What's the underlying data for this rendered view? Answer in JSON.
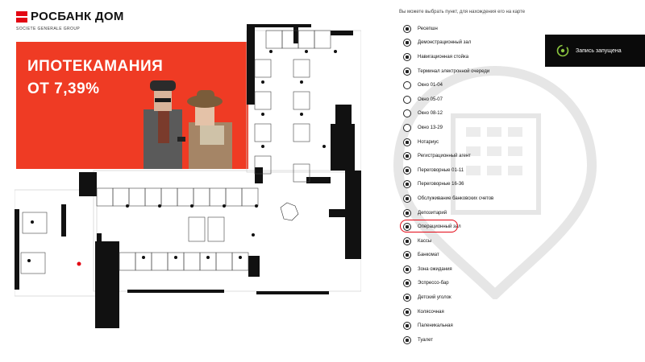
{
  "brand": {
    "name": "РОСБАНК ДОМ",
    "subtitle": "SOCIETE GENERALE GROUP",
    "color": "#e30613"
  },
  "promo": {
    "title": "ИПОТЕКАМАНИЯ",
    "rate": "ОТ 7,39%",
    "background": "#ef3b24"
  },
  "hint": "Вы можете выбрать пункт, для нахождения его на карте",
  "legend": [
    {
      "label": "Ресепшн",
      "icon": "reception-icon"
    },
    {
      "label": "Демонстрационный зал",
      "icon": "showroom-icon"
    },
    {
      "label": "Навигационная стойка",
      "icon": "navigation-stand-icon"
    },
    {
      "label": "Терминал электронной очереди",
      "icon": "queue-terminal-icon"
    },
    {
      "label": "Окно 01-04",
      "icon": "window-icon"
    },
    {
      "label": "Окно 05-07",
      "icon": "window-icon"
    },
    {
      "label": "Окно 08-12",
      "icon": "window-icon"
    },
    {
      "label": "Окно 13-29",
      "icon": "window-icon"
    },
    {
      "label": "Нотариус",
      "icon": "notary-icon"
    },
    {
      "label": "Регистрационный агент",
      "icon": "registration-agent-icon"
    },
    {
      "label": "Переговорные 01-11",
      "icon": "meeting-room-icon"
    },
    {
      "label": "Переговорные 16-36",
      "icon": "meeting-room-icon"
    },
    {
      "label": "Обслуживание банковских счетов",
      "icon": "bank-account-icon"
    },
    {
      "label": "Депозитарий",
      "icon": "depository-icon"
    },
    {
      "label": "Операционный зал",
      "icon": "operations-hall-icon",
      "selected": true
    },
    {
      "label": "Кассы",
      "icon": "cashier-icon"
    },
    {
      "label": "Банкомат",
      "icon": "atm-icon"
    },
    {
      "label": "Зона ожидания",
      "icon": "waiting-area-icon"
    },
    {
      "label": "Эспрессо-бар",
      "icon": "espresso-bar-icon"
    },
    {
      "label": "Детский уголок",
      "icon": "kids-corner-icon"
    },
    {
      "label": "Колясочная",
      "icon": "stroller-room-icon"
    },
    {
      "label": "Паленикальная",
      "icon": "manicure-icon"
    },
    {
      "label": "Туалет",
      "icon": "toilet-icon"
    }
  ],
  "toast": {
    "text": "Запись запущена",
    "icon": "recording-icon",
    "accent": "#8cc63f"
  }
}
